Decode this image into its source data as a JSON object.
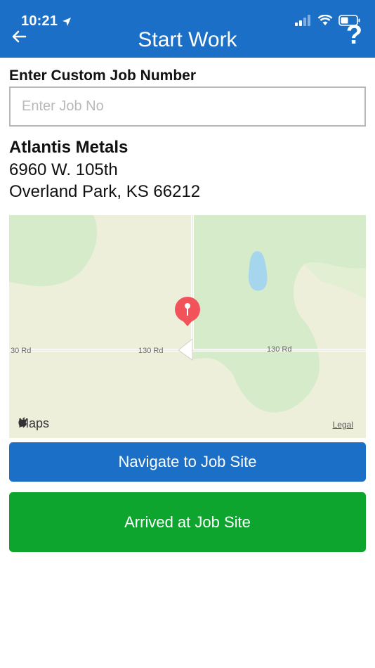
{
  "status_bar": {
    "time": "10:21"
  },
  "header": {
    "title": "Start Work",
    "help_label": "?"
  },
  "job_number": {
    "label": "Enter Custom Job Number",
    "placeholder": "Enter Job No",
    "value": ""
  },
  "address": {
    "company": "Atlantis Metals",
    "street": "6960 W. 105th",
    "city_state_zip": "Overland Park, KS 66212"
  },
  "map": {
    "brand": "Maps",
    "legal": "Legal",
    "road_labels": [
      "30 Rd",
      "130 Rd",
      "130 Rd"
    ],
    "colors": {
      "land": "#eeefdb",
      "park": "#d6ebc9",
      "water": "#a5d6ee",
      "road": "#ffffff",
      "pin": "#f2525a"
    }
  },
  "actions": {
    "navigate_label": "Navigate to Job Site",
    "arrived_label": "Arrived at Job Site"
  },
  "colors": {
    "primary": "#1b6fc6",
    "success": "#0ea52e"
  }
}
